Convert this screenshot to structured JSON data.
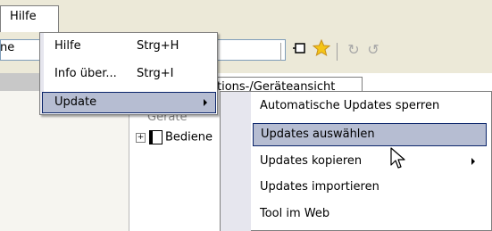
{
  "menubar": {
    "hilfe_label": "Hilfe"
  },
  "background": {
    "addr_fragment": "ne",
    "tab_label": "tions-/Geräteansicht",
    "tree_label": "Bediene",
    "tree_partial": "Geräte"
  },
  "dropdown": {
    "items": [
      {
        "label": "Hilfe",
        "shortcut": "Strg+H"
      },
      {
        "label": "Info über...",
        "shortcut": "Strg+I"
      },
      {
        "label": "Update",
        "shortcut": ""
      }
    ]
  },
  "submenu": {
    "items": [
      {
        "label": "Automatische Updates sperren"
      },
      {
        "label": "Updates auswählen"
      },
      {
        "label": "Updates kopieren"
      },
      {
        "label": "Updates importieren"
      },
      {
        "label": "Tool im Web"
      }
    ]
  },
  "colors": {
    "highlight": "#b6bdd2",
    "highlight_border": "#0a246a",
    "menubar": "#ece9d8"
  },
  "icons": [
    "device-icon",
    "star-icon",
    "refresh-icon",
    "undo-icon"
  ]
}
